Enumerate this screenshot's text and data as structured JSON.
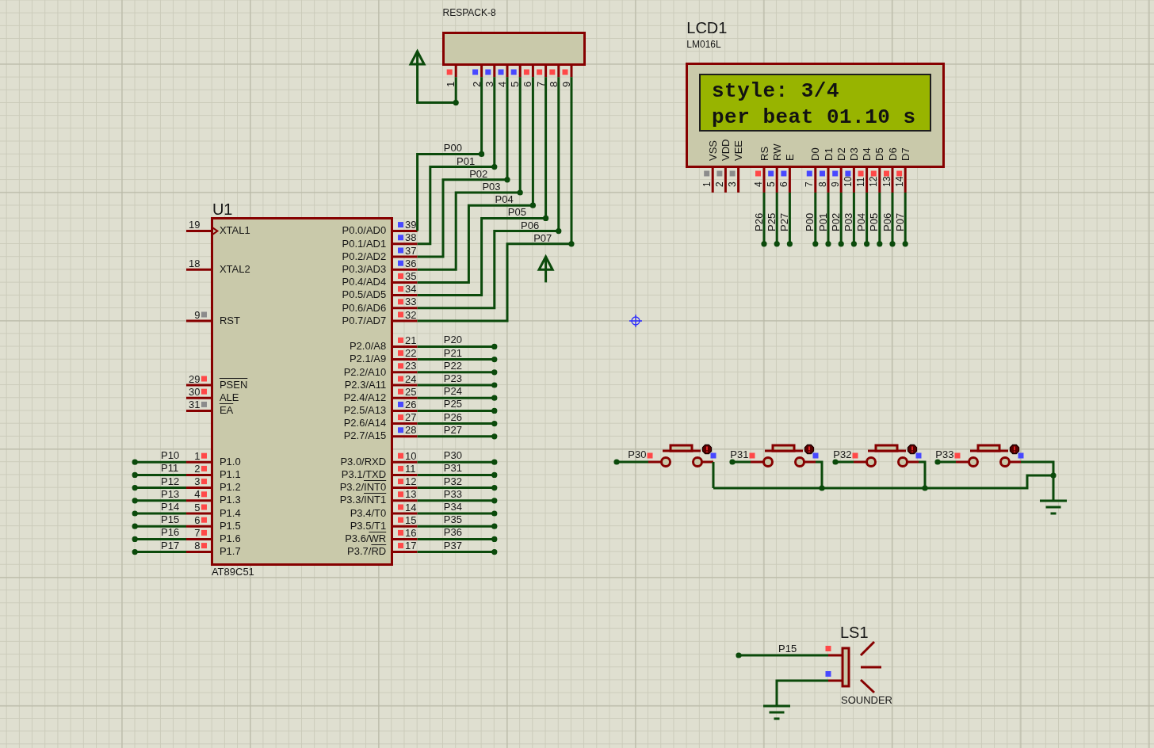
{
  "mcu": {
    "ref": "U1",
    "part": "AT89C51",
    "left_pins": [
      {
        "number": "19",
        "name": "XTAL1",
        "clock": true
      },
      {
        "number": "18",
        "name": "XTAL2",
        "clock": false
      },
      {
        "number": "9",
        "name": "RST",
        "clock": false,
        "color": "#8c8c8c"
      },
      {
        "number": "29",
        "bar": "PSEN",
        "clock": false,
        "color": "#ff4848"
      },
      {
        "number": "30",
        "name": "ALE",
        "clock": false,
        "color": "#ff4848"
      },
      {
        "number": "31",
        "bar": "EA",
        "clock": false,
        "color": "#8c8c8c"
      },
      {
        "number": "1",
        "name": "P1.0",
        "clock": false,
        "color": "#ff4848",
        "net": "P10"
      },
      {
        "number": "2",
        "name": "P1.1",
        "clock": false,
        "color": "#ff4848",
        "net": "P11"
      },
      {
        "number": "3",
        "name": "P1.2",
        "clock": false,
        "color": "#ff4848",
        "net": "P12"
      },
      {
        "number": "4",
        "name": "P1.3",
        "clock": false,
        "color": "#ff4848",
        "net": "P13"
      },
      {
        "number": "5",
        "name": "P1.4",
        "clock": false,
        "color": "#ff4848",
        "net": "P14"
      },
      {
        "number": "6",
        "name": "P1.5",
        "clock": false,
        "color": "#ff4848",
        "net": "P15"
      },
      {
        "number": "7",
        "name": "P1.6",
        "clock": false,
        "color": "#ff4848",
        "net": "P16"
      },
      {
        "number": "8",
        "name": "P1.7",
        "clock": false,
        "color": "#ff4848",
        "net": "P17"
      }
    ],
    "right_pins": [
      {
        "number": "39",
        "name": "P0.0/AD0",
        "color": "#4848ff",
        "net": "P00"
      },
      {
        "number": "38",
        "name": "P0.1/AD1",
        "color": "#4848ff",
        "net": "P01"
      },
      {
        "number": "37",
        "name": "P0.2/AD2",
        "color": "#4848ff",
        "net": "P02"
      },
      {
        "number": "36",
        "name": "P0.3/AD3",
        "color": "#4848ff",
        "net": "P03"
      },
      {
        "number": "35",
        "name": "P0.4/AD4",
        "color": "#ff4848",
        "net": "P04"
      },
      {
        "number": "34",
        "name": "P0.5/AD5",
        "color": "#ff4848",
        "net": "P05"
      },
      {
        "number": "33",
        "name": "P0.6/AD6",
        "color": "#ff4848",
        "net": "P06"
      },
      {
        "number": "32",
        "name": "P0.7/AD7",
        "color": "#ff4848",
        "net": "P07"
      },
      {
        "number": "21",
        "name": "P2.0/A8",
        "color": "#ff4848",
        "net": "P20"
      },
      {
        "number": "22",
        "name": "P2.1/A9",
        "color": "#ff4848",
        "net": "P21"
      },
      {
        "number": "23",
        "name": "P2.2/A10",
        "color": "#ff4848",
        "net": "P22"
      },
      {
        "number": "24",
        "name": "P2.3/A11",
        "color": "#ff4848",
        "net": "P23"
      },
      {
        "number": "25",
        "name": "P2.4/A12",
        "color": "#ff4848",
        "net": "P24"
      },
      {
        "number": "26",
        "name": "P2.5/A13",
        "color": "#4848ff",
        "net": "P25"
      },
      {
        "number": "27",
        "name": "P2.6/A14",
        "color": "#ff4848",
        "net": "P26"
      },
      {
        "number": "28",
        "name": "P2.7/A15",
        "color": "#4848ff",
        "net": "P27"
      },
      {
        "number": "10",
        "name": "P3.0/RXD",
        "color": "#ff4848",
        "net": "P30"
      },
      {
        "number": "11",
        "name": "P3.1/TXD",
        "color": "#ff4848",
        "net": "P31"
      },
      {
        "number": "12",
        "name": "P3.2/",
        "bar": "INT0",
        "color": "#ff4848",
        "net": "P32"
      },
      {
        "number": "13",
        "name": "P3.3/",
        "bar": "INT1",
        "color": "#ff4848",
        "net": "P33"
      },
      {
        "number": "14",
        "name": "P3.4/T0",
        "color": "#ff4848",
        "net": "P34"
      },
      {
        "number": "15",
        "name": "P3.5/T1",
        "color": "#ff4848",
        "net": "P35"
      },
      {
        "number": "16",
        "name": "P3.6/",
        "bar": "WR",
        "color": "#ff4848",
        "net": "P36"
      },
      {
        "number": "17",
        "name": "P3.7/",
        "bar": "RD",
        "color": "#ff4848",
        "net": "P37"
      }
    ]
  },
  "resistor_pack": {
    "part": "RESPACK-8",
    "pins": [
      {
        "number": "1",
        "color": "#ff4848"
      },
      {
        "number": "2",
        "color": "#4848ff"
      },
      {
        "number": "3",
        "color": "#4848ff"
      },
      {
        "number": "4",
        "color": "#4848ff"
      },
      {
        "number": "5",
        "color": "#4848ff"
      },
      {
        "number": "6",
        "color": "#ff4848"
      },
      {
        "number": "7",
        "color": "#ff4848"
      },
      {
        "number": "8",
        "color": "#ff4848"
      },
      {
        "number": "9",
        "color": "#ff4848"
      }
    ]
  },
  "lcd": {
    "ref": "LCD1",
    "part": "LM016L",
    "lines": [
      "style: 3/4",
      "per beat 01.10 s"
    ],
    "pins": [
      {
        "number": "1",
        "name": "VSS",
        "color": "#8c8c8c"
      },
      {
        "number": "2",
        "name": "VDD",
        "color": "#8c8c8c"
      },
      {
        "number": "3",
        "name": "VEE",
        "color": "#8c8c8c"
      },
      {
        "number": "4",
        "name": "RS",
        "color": "#ff4848",
        "net": "P26"
      },
      {
        "number": "5",
        "name": "RW",
        "color": "#4848ff",
        "net": "P25"
      },
      {
        "number": "6",
        "name": "E",
        "color": "#4848ff",
        "net": "P27"
      },
      {
        "number": "7",
        "name": "D0",
        "color": "#4848ff",
        "net": "P00"
      },
      {
        "number": "8",
        "name": "D1",
        "color": "#4848ff",
        "net": "P01"
      },
      {
        "number": "9",
        "name": "D2",
        "color": "#4848ff",
        "net": "P02"
      },
      {
        "number": "10",
        "name": "D3",
        "color": "#4848ff",
        "net": "P03"
      },
      {
        "number": "11",
        "name": "D4",
        "color": "#ff4848",
        "net": "P04"
      },
      {
        "number": "12",
        "name": "D5",
        "color": "#ff4848",
        "net": "P05"
      },
      {
        "number": "13",
        "name": "D6",
        "color": "#ff4848",
        "net": "P06"
      },
      {
        "number": "14",
        "name": "D7",
        "color": "#ff4848",
        "net": "P07"
      }
    ]
  },
  "buttons": [
    {
      "net": "P30",
      "pins": [
        {
          "color": "#ff4848"
        },
        {
          "color": "#4848ff"
        }
      ]
    },
    {
      "net": "P31",
      "pins": [
        {
          "color": "#ff4848"
        },
        {
          "color": "#4848ff"
        }
      ]
    },
    {
      "net": "P32",
      "pins": [
        {
          "color": "#ff4848"
        },
        {
          "color": "#4848ff"
        }
      ]
    },
    {
      "net": "P33",
      "pins": [
        {
          "color": "#ff4848"
        },
        {
          "color": "#4848ff"
        }
      ]
    }
  ],
  "sounder": {
    "ref": "LS1",
    "part": "SOUNDER",
    "net": "P15",
    "pins": [
      {
        "color": "#ff4848"
      },
      {
        "color": "#4848ff"
      }
    ]
  }
}
